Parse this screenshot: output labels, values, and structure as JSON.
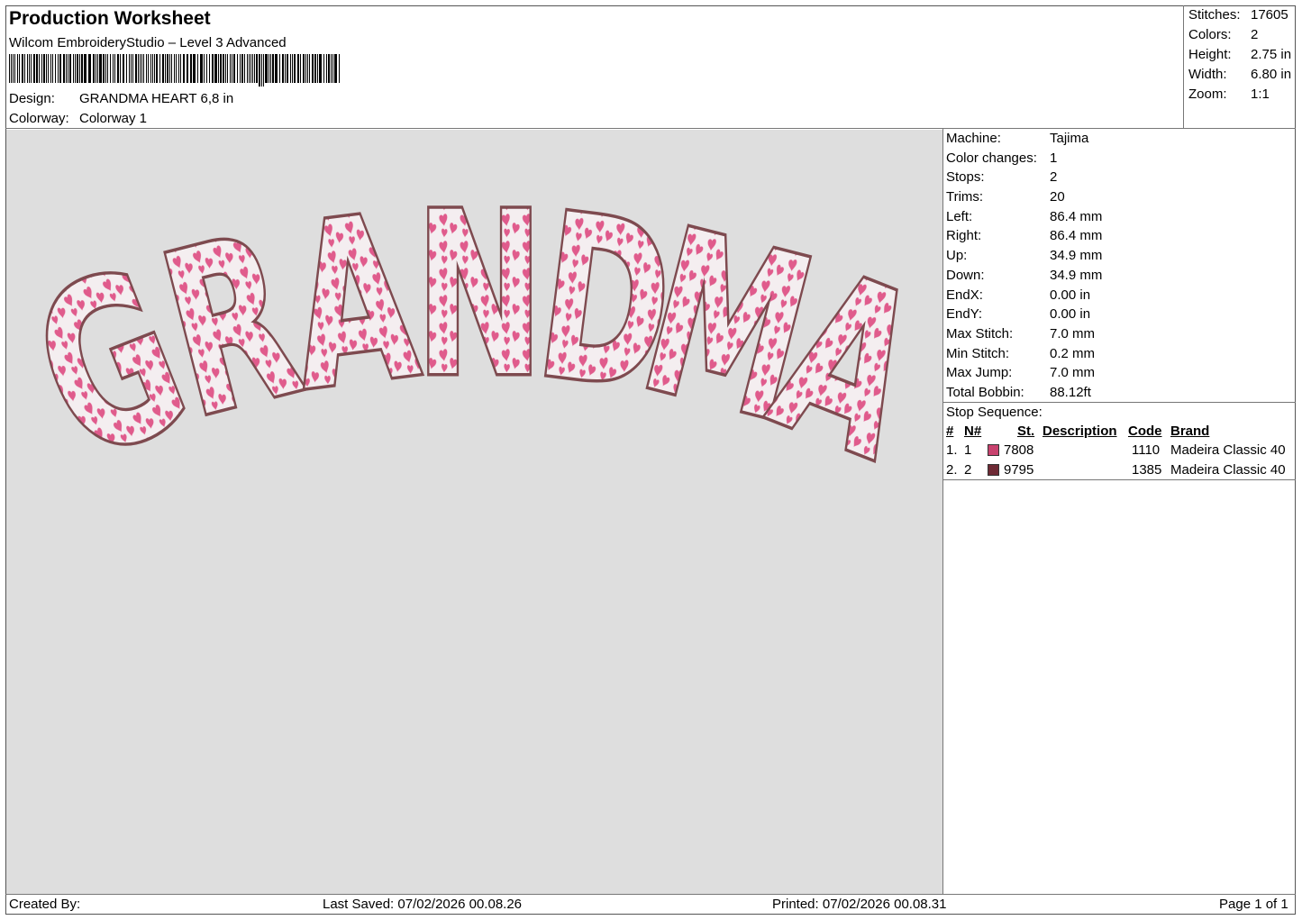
{
  "header": {
    "title": "Production Worksheet",
    "subtitle": "Wilcom EmbroideryStudio – Level 3 Advanced",
    "design_label": "Design:",
    "design_value": "GRANDMA HEART 6,8 in",
    "colorway_label": "Colorway:",
    "colorway_value": "Colorway 1"
  },
  "stats": [
    {
      "label": "Stitches:",
      "value": "17605"
    },
    {
      "label": "Colors:",
      "value": "2"
    },
    {
      "label": "Height:",
      "value": "2.75 in"
    },
    {
      "label": "Width:",
      "value": "6.80 in"
    },
    {
      "label": "Zoom:",
      "value": "1:1"
    }
  ],
  "machine_info": [
    {
      "label": "Machine:",
      "value": "Tajima"
    },
    {
      "label": "Color changes:",
      "value": "1"
    },
    {
      "label": "Stops:",
      "value": "2"
    },
    {
      "label": "Trims:",
      "value": "20"
    },
    {
      "label": "Left:",
      "value": "86.4 mm"
    },
    {
      "label": "Right:",
      "value": "86.4 mm"
    },
    {
      "label": "Up:",
      "value": "34.9 mm"
    },
    {
      "label": "Down:",
      "value": "34.9 mm"
    },
    {
      "label": "EndX:",
      "value": "0.00 in"
    },
    {
      "label": "EndY:",
      "value": "0.00 in"
    },
    {
      "label": "Max Stitch:",
      "value": "7.0 mm"
    },
    {
      "label": "Min Stitch:",
      "value": "0.2 mm"
    },
    {
      "label": "Max Jump:",
      "value": "7.0 mm"
    },
    {
      "label": "Total Bobbin:",
      "value": "88.12ft"
    }
  ],
  "stop_sequence": {
    "title": "Stop Sequence:",
    "headers": {
      "num": "#",
      "n": "N#",
      "st": "St.",
      "description": "Description",
      "code": "Code",
      "brand": "Brand"
    },
    "rows": [
      {
        "num": "1.",
        "n": "1",
        "color": "#c8426e",
        "st": "7808",
        "description": "",
        "code": "1110",
        "brand": "Madeira Classic 40"
      },
      {
        "num": "2.",
        "n": "2",
        "color": "#6e2a35",
        "st": "9795",
        "description": "",
        "code": "1385",
        "brand": "Madeira Classic 40"
      }
    ]
  },
  "design_preview": {
    "text": "GRANDMA",
    "outline_color": "#7e4a4f",
    "fill_color": "#f4eef0",
    "heart_color": "#e05b8c"
  },
  "footer": {
    "created_by": "Created By:",
    "last_saved": "Last Saved: 07/02/2026 00.08.26",
    "printed": "Printed: 07/02/2026 00.08.31",
    "page": "Page 1 of 1"
  }
}
